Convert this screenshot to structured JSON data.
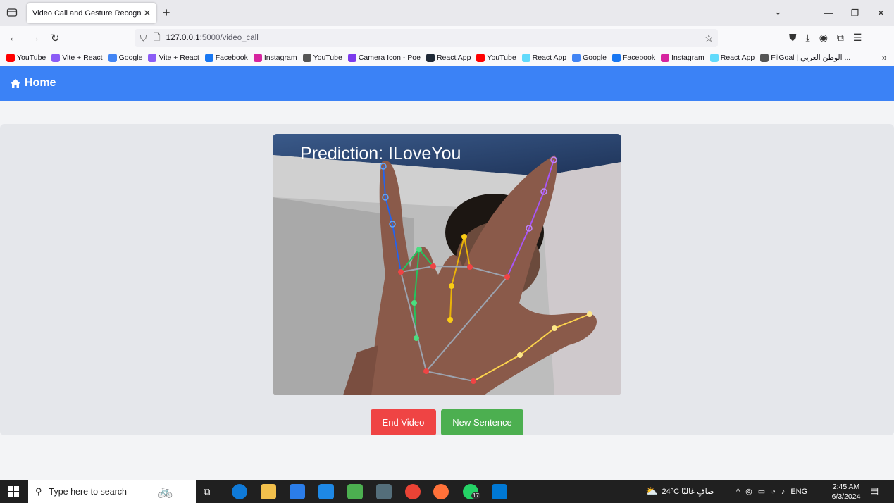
{
  "browser": {
    "tab_title": "Video Call and Gesture Recognition",
    "url_host": "127.0.0.1",
    "url_path": ":5000/video_call",
    "bookmarks": [
      {
        "label": "YouTube",
        "icon": "youtube-icon",
        "color": "#ff0000"
      },
      {
        "label": "Vite + React",
        "icon": "vite-icon",
        "color": "#8b5cf6"
      },
      {
        "label": "Google",
        "icon": "google-icon",
        "color": "#4285f4"
      },
      {
        "label": "Vite + React",
        "icon": "vite-icon",
        "color": "#8b5cf6"
      },
      {
        "label": "Facebook",
        "icon": "facebook-icon",
        "color": "#1877f2"
      },
      {
        "label": "Instagram",
        "icon": "instagram-icon",
        "color": "#d6249f"
      },
      {
        "label": "YouTube",
        "icon": "globe-icon",
        "color": "#555555"
      },
      {
        "label": "Camera Icon - Poe",
        "icon": "poe-icon",
        "color": "#7c3aed"
      },
      {
        "label": "React App",
        "icon": "react-icon",
        "color": "#1f2937"
      },
      {
        "label": "YouTube",
        "icon": "youtube-icon",
        "color": "#ff0000"
      },
      {
        "label": "React App",
        "icon": "react-icon",
        "color": "#61dafb"
      },
      {
        "label": "Google",
        "icon": "google-icon",
        "color": "#4285f4"
      },
      {
        "label": "Facebook",
        "icon": "facebook-icon",
        "color": "#1877f2"
      },
      {
        "label": "Instagram",
        "icon": "instagram-icon",
        "color": "#d6249f"
      },
      {
        "label": "React App",
        "icon": "react-icon",
        "color": "#61dafb"
      },
      {
        "label": "FilGoal | الوطن العربي ...",
        "icon": "globe-icon",
        "color": "#555555"
      }
    ]
  },
  "app": {
    "home_label": "Home",
    "prediction_text": "Prediction:  ILoveYou",
    "end_button": "End Video",
    "new_sentence_button": "New Sentence"
  },
  "taskbar": {
    "search_placeholder": "Type here to search",
    "weather": "24°C  صافٍ غالبًا",
    "language": "ENG",
    "time": "2:45 AM",
    "date": "6/3/2024",
    "whatsapp_badge": "17"
  }
}
